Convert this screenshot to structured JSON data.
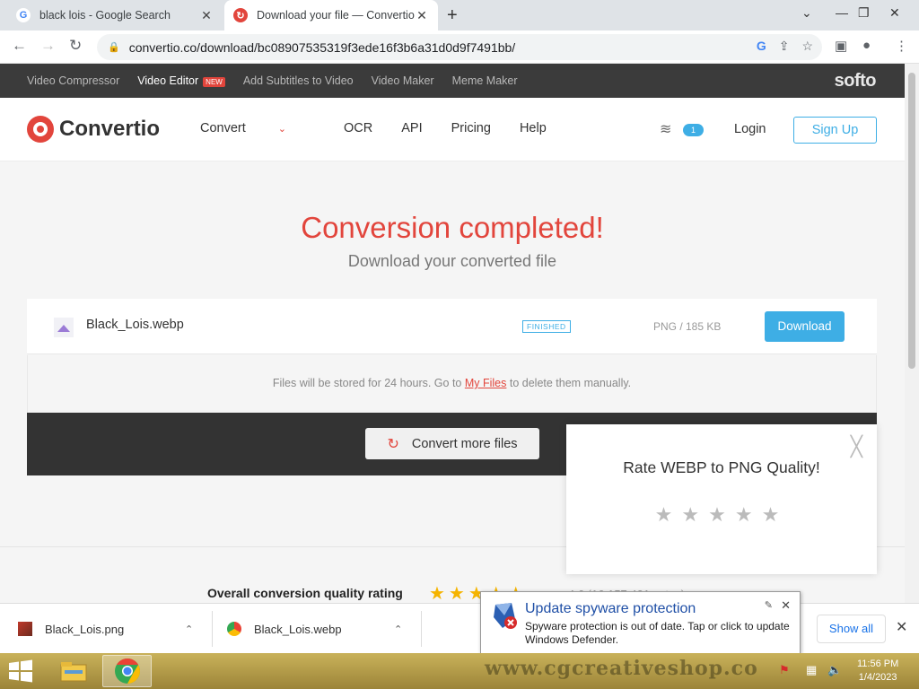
{
  "browser": {
    "tabs": [
      {
        "title": "black lois - Google Search",
        "favicon": "google-icon"
      },
      {
        "title": "Download your file — Convertio",
        "favicon": "convertio-icon"
      }
    ],
    "url": "convertio.co/download/bc08907535319f3ede16f3b6a31d0d9f7491bb/"
  },
  "topbar": {
    "items": [
      "Video Compressor",
      "Video Editor",
      "Add Subtitles to Video",
      "Video Maker",
      "Meme Maker"
    ],
    "new_badge": "NEW",
    "brand": "softo"
  },
  "nav": {
    "logo": "Convertio",
    "links": [
      "Convert",
      "OCR",
      "API",
      "Pricing",
      "Help"
    ],
    "layers_count": "1",
    "login": "Login",
    "signup": "Sign Up"
  },
  "main": {
    "headline": "Conversion completed!",
    "subheadline": "Download your converted file",
    "file": {
      "name": "Black_Lois.webp",
      "status": "FINISHED",
      "info": "PNG / 185 KB",
      "download_label": "Download"
    },
    "storage_note_pre": "Files will be stored for 24 hours. Go to",
    "storage_link": "My Files",
    "storage_note_post": "to delete them manually.",
    "convert_more": "Convert more files",
    "overall_rating_label": "Overall conversion quality rating",
    "overall_rating_partial": "4.6 (16,157,401 votes)"
  },
  "rating_popup": {
    "question": "Rate WEBP to PNG Quality!",
    "stars": 5
  },
  "downloads": {
    "items": [
      "Black_Lois.png",
      "Black_Lois.webp"
    ],
    "show_all": "Show all"
  },
  "notification": {
    "title": "Update spyware protection",
    "text": "Spyware protection is out of date. Tap or click to update Windows Defender."
  },
  "taskbar": {
    "watermark": "www.cgcreativeshop.co",
    "time": "11:56 PM",
    "date": "1/4/2023"
  }
}
